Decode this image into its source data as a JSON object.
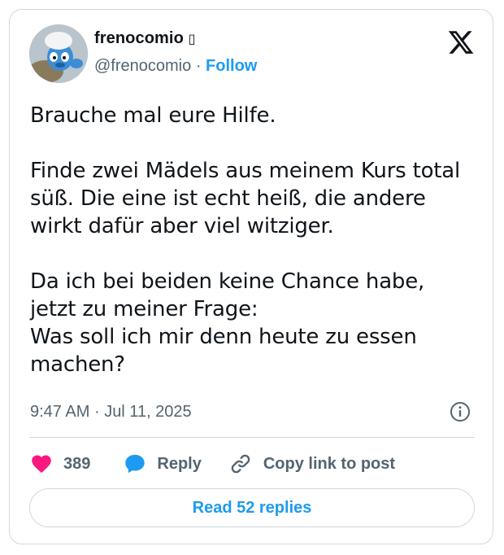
{
  "author": {
    "display_name": "frenocomio",
    "name_suffix_glyph": "▯",
    "handle": "@frenocomio",
    "separator": "·",
    "follow_label": "Follow"
  },
  "tweet": {
    "text": "Brauche mal eure Hilfe.\n\nFinde zwei Mädels aus meinem Kurs total süß. Die eine ist echt heiß, die andere wirkt dafür aber viel witziger.\n\nDa ich bei beiden keine Chance habe, jetzt zu meiner Frage:\nWas soll ich mir denn heute zu essen machen?",
    "time": "9:47 AM",
    "date_separator": "·",
    "date": "Jul 11, 2025"
  },
  "actions": {
    "like_count": "389",
    "reply_label": "Reply",
    "copy_link_label": "Copy link to post"
  },
  "read_replies_label": "Read 52 replies",
  "colors": {
    "accent": "#1d9bf0",
    "like": "#f91880",
    "muted": "#536471",
    "border": "#cfd9de"
  },
  "icons": [
    "x-logo-icon",
    "info-icon",
    "heart-icon",
    "reply-bubble-icon",
    "link-icon"
  ]
}
